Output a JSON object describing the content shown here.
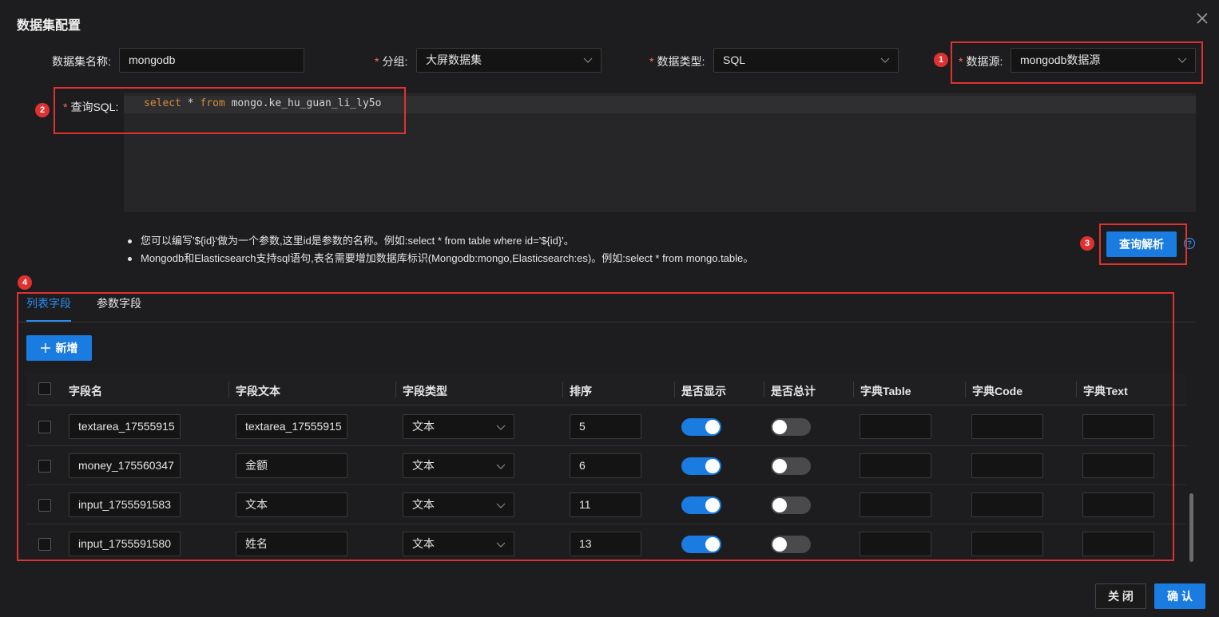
{
  "dialog": {
    "title": "数据集配置"
  },
  "form": {
    "name_label": "数据集名称:",
    "name_value": "mongodb",
    "group_label": "分组:",
    "group_value": "大屏数据集",
    "type_label": "数据类型:",
    "type_value": "SQL",
    "source_label": "数据源:",
    "source_value": "mongodb数据源",
    "sql_label": "查询SQL:",
    "required_mark": "*"
  },
  "sql": {
    "kw_select": "select",
    "star": " * ",
    "kw_from": "from",
    "table": " mongo.ke_hu_guan_li_ly5o"
  },
  "tips": [
    "您可以编写'${id}'做为一个参数,这里id是参数的名称。例如:select * from table where id='${id}'。",
    "Mongodb和Elasticsearch支持sql语句,表名需要增加数据库标识(Mongodb:mongo,Elasticsearch:es)。例如:select * from mongo.table。"
  ],
  "buttons": {
    "parse": "查询解析",
    "add": "新增",
    "close": "关 闭",
    "confirm": "确 认"
  },
  "badges": [
    "1",
    "2",
    "3",
    "4"
  ],
  "tabs": [
    "列表字段",
    "参数字段"
  ],
  "table": {
    "headers": [
      "字段名",
      "字段文本",
      "字段类型",
      "排序",
      "是否显示",
      "是否总计",
      "字典Table",
      "字典Code",
      "字典Text"
    ],
    "rows": [
      {
        "field": "textarea_17555915",
        "text": "textarea_17555915",
        "type": "文本",
        "order": "5",
        "show": true,
        "total": false
      },
      {
        "field": "money_175560347",
        "text": "金额",
        "type": "文本",
        "order": "6",
        "show": true,
        "total": false
      },
      {
        "field": "input_1755591583",
        "text": "文本",
        "type": "文本",
        "order": "11",
        "show": true,
        "total": false
      },
      {
        "field": "input_1755591580",
        "text": "姓名",
        "type": "文本",
        "order": "13",
        "show": true,
        "total": false
      }
    ]
  },
  "colors": {
    "accent": "#1a7ce0",
    "callout": "#e03131",
    "keyword": "#d48b3c"
  },
  "icons": [
    "close-icon",
    "chevron-down-icon",
    "help-icon",
    "plus-icon"
  ]
}
